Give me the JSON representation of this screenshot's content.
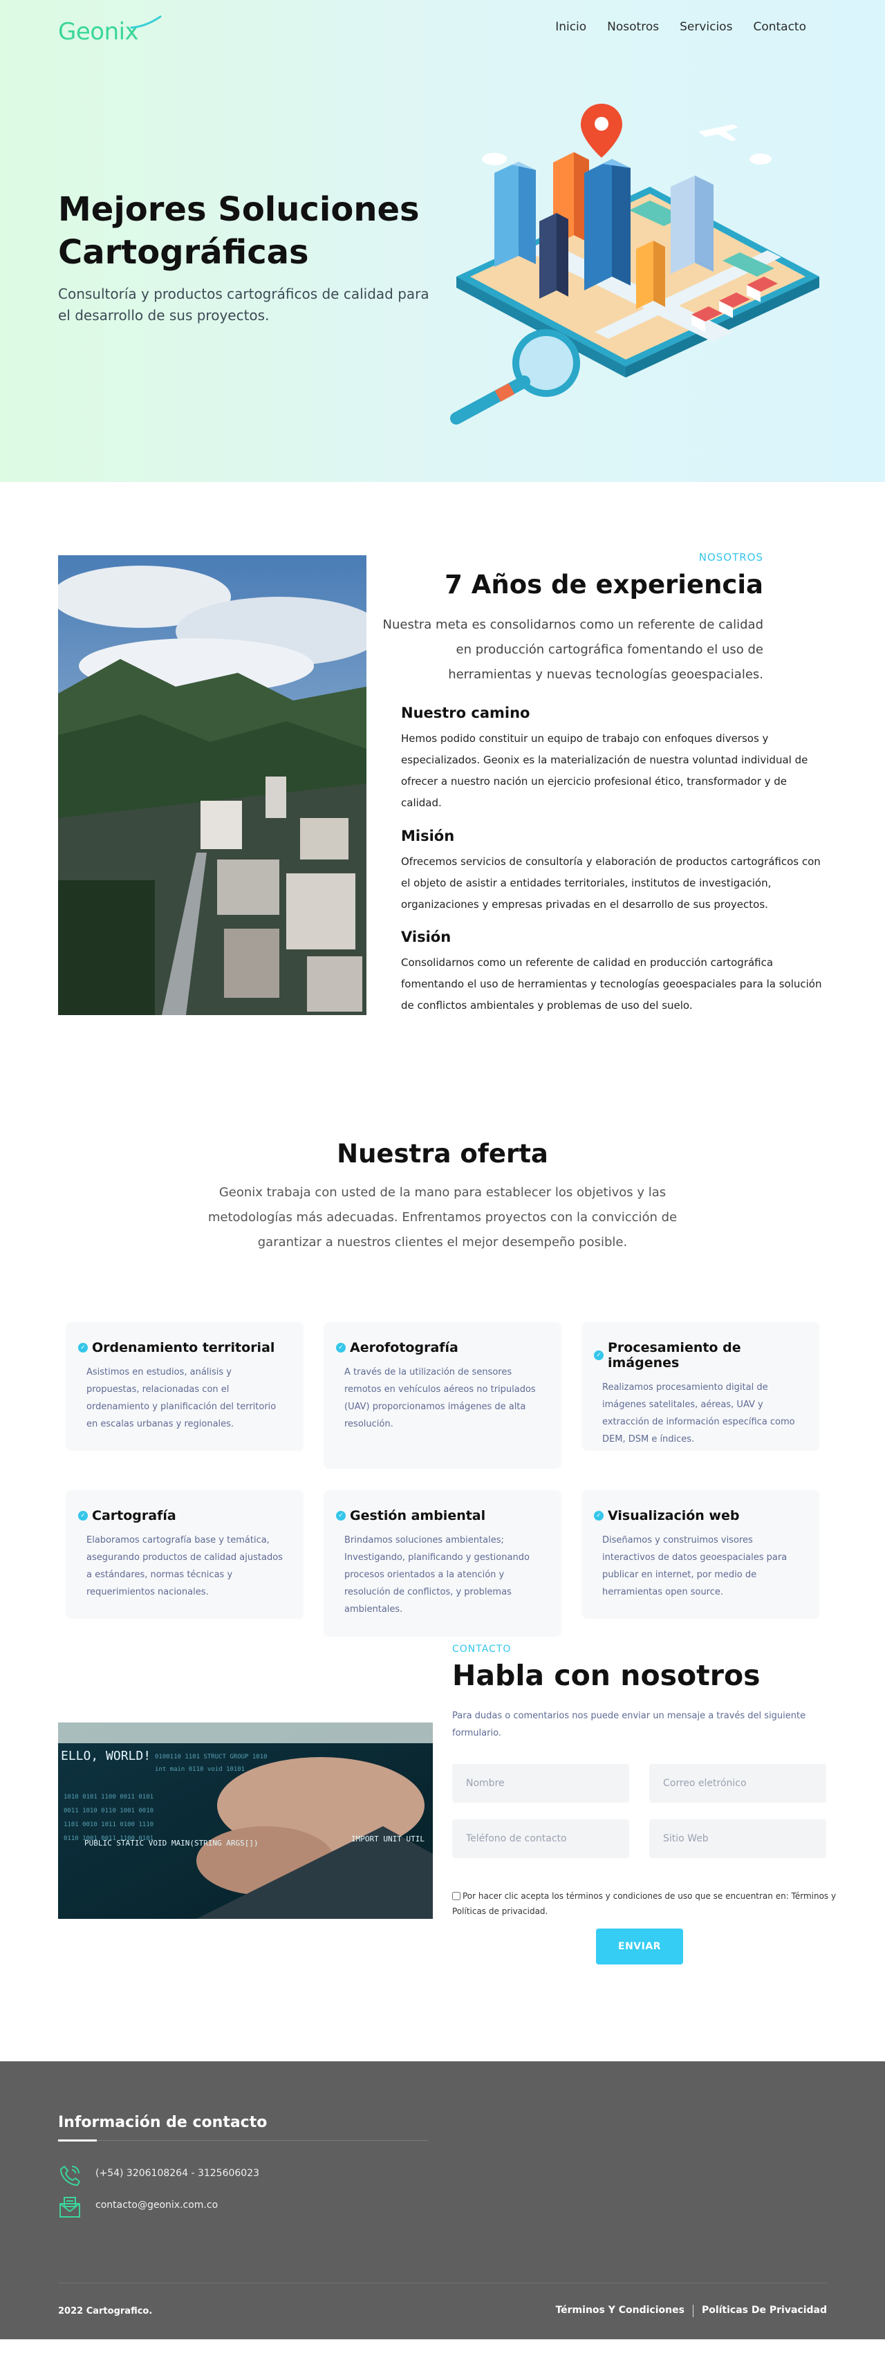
{
  "nav": {
    "logo": "Geonix",
    "links": [
      "Inicio",
      "Nosotros",
      "Servicios",
      "Contacto"
    ]
  },
  "hero": {
    "title": "Mejores Soluciones Cartográficas",
    "subtitle": "Consultoría y productos cartográficos de calidad para el desarrollo de sus proyectos."
  },
  "about": {
    "tag": "NOSOTROS",
    "title": "7 Años de experiencia",
    "lead": "Nuestra meta es consolidarnos como un referente de calidad en producción cartográfica fomentando el uso de herramientas y nuevas tecnologías geoespaciales.",
    "blocks": [
      {
        "title": "Nuestro camino",
        "text": "Hemos podido constituir un equipo de trabajo con enfoques diversos y especializados. Geonix es la materialización de nuestra voluntad individual de ofrecer a nuestro nación un ejercicio profesional ético, transformador y de calidad."
      },
      {
        "title": "Misión",
        "text": "Ofrecemos servicios de consultoría y elaboración de productos cartográficos con el objeto de asistir a entidades territoriales, institutos de investigación, organizaciones y empresas privadas en el desarrollo de sus proyectos."
      },
      {
        "title": "Visión",
        "text": "Consolidarnos como un referente de calidad en producción cartográfica fomentando el uso de herramientas y tecnologías geoespaciales para la solución de conflictos ambientales y problemas de uso del suelo."
      }
    ]
  },
  "offer": {
    "title": "Nuestra oferta",
    "lead": "Geonix trabaja con usted de la mano para establecer los objetivos y las metodologías más adecuadas.  Enfrentamos proyectos con la convicción de garantizar a nuestros clientes el mejor desempeño posible.",
    "cards": [
      {
        "title": "Ordenamiento territorial",
        "text": "Asistimos en estudios, análisis y propuestas, relacionadas con el ordenamiento y planificación del territorio en escalas urbanas y regionales."
      },
      {
        "title": "Aerofotografía",
        "text": "A través de la utilización de sensores remotos en vehículos aéreos no tripulados (UAV) proporcionamos imágenes de alta resolución."
      },
      {
        "title": "Procesamiento de imágenes",
        "text": "Realizamos procesamiento digital de imágenes satelitales, aéreas, UAV y extracción de información específica como DEM, DSM e índices."
      },
      {
        "title": "Cartografía",
        "text": "Elaboramos cartografía base y temática, asegurando productos de calidad ajustados a estándares, normas técnicas y requerimientos nacionales."
      },
      {
        "title": "Gestión ambiental",
        "text": "Brindamos soluciones ambientales; Investigando, planificando y gestionando procesos orientados a la atención y resolución de conflictos, y problemas ambientales."
      },
      {
        "title": "Visualización web",
        "text": "Diseñamos y construimos visores interactivos de datos geoespaciales para publicar en internet, por medio de herramientas open source."
      }
    ]
  },
  "contact": {
    "tag": "CONTACTO",
    "title": "Habla con nosotros",
    "lead": "Para dudas o comentarios nos puede enviar un mensaje a través del siguiente formulario.",
    "photo_text": [
      "ELLO, WORLD!",
      "PUBLIC STATIC VOID MAIN(STRING ARGS[])",
      "IMPORT UNIT UTIL"
    ],
    "fields": {
      "name": "Nombre",
      "email": "Correo eletrónico",
      "phone": "Teléfono de contacto",
      "web": "Sitio Web"
    },
    "terms": "Por hacer clic acepta los términos y condiciones de uso que se encuentran en: Términos y Políticas de privacidad.",
    "send": "ENVIAR"
  },
  "footer": {
    "title": "Información de contacto",
    "phone": "(+54) 3206108264 - 3125606023",
    "email": "contacto@geonix.com.co",
    "copyright": "2022 Cartografico.",
    "links": [
      "Términos Y Condiciones",
      "Políticas De Privacidad"
    ]
  }
}
